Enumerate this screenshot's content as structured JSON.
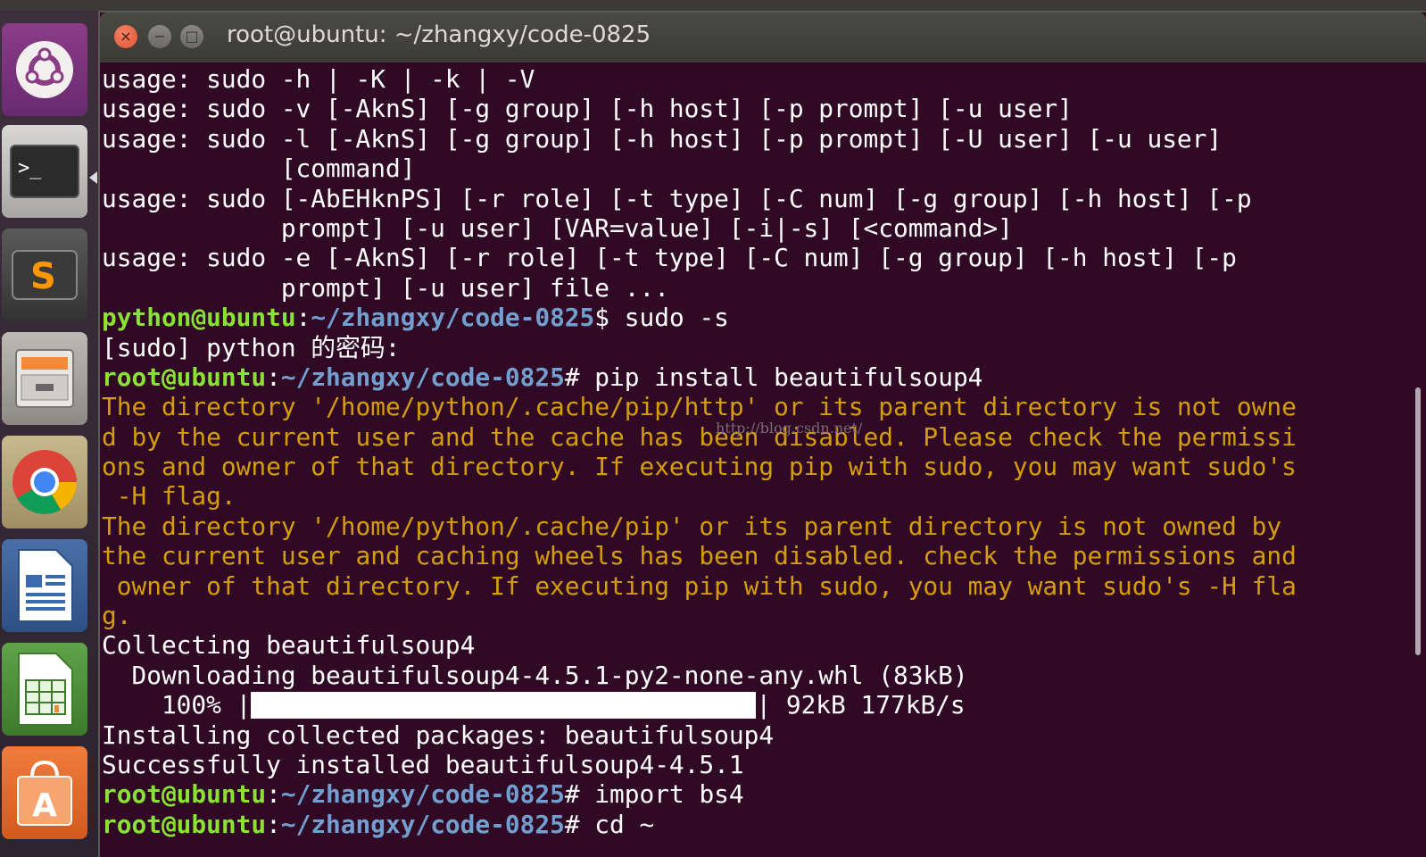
{
  "topbar": {
    "label": ""
  },
  "launcher": {
    "items": [
      {
        "name": "Ubuntu Dash",
        "icon": "ubuntu-logo-icon"
      },
      {
        "name": "Terminal",
        "icon": "terminal-icon",
        "active": true
      },
      {
        "name": "Sublime Text",
        "icon": "sublime-text-icon"
      },
      {
        "name": "Files",
        "icon": "file-cabinet-icon"
      },
      {
        "name": "Chrome",
        "icon": "chrome-icon"
      },
      {
        "name": "LibreOffice Writer",
        "icon": "writer-document-icon"
      },
      {
        "name": "LibreOffice Calc",
        "icon": "calc-spreadsheet-icon"
      },
      {
        "name": "Software Center",
        "icon": "shopping-bag-icon"
      }
    ]
  },
  "window": {
    "title": "root@ubuntu: ~/zhangxy/code-0825",
    "buttons": {
      "close": "×",
      "minimize": "−",
      "maximize": "□"
    }
  },
  "terminal": {
    "colors": {
      "background": "#300a24",
      "text": "#ffffff",
      "warning": "#d59d0d",
      "user_host": "#8ae234",
      "path": "#729fcf"
    },
    "watermark": "http://blog.csdn.net/",
    "lines": [
      {
        "text": "usage: sudo -h | -K | -k | -V"
      },
      {
        "text": "usage: sudo -v [-AknS] [-g group] [-h host] [-p prompt] [-u user]"
      },
      {
        "text": "usage: sudo -l [-AknS] [-g group] [-h host] [-p prompt] [-U user] [-u user]"
      },
      {
        "text": "            [command]"
      },
      {
        "text": "usage: sudo [-AbEHknPS] [-r role] [-t type] [-C num] [-g group] [-h host] [-p"
      },
      {
        "text": "            prompt] [-u user] [VAR=value] [-i|-s] [<command>]"
      },
      {
        "text": "usage: sudo -e [-AknS] [-r role] [-t type] [-C num] [-g group] [-h host] [-p"
      },
      {
        "text": "            prompt] [-u user] file ..."
      },
      {
        "prompt": {
          "userhost": "python@ubuntu",
          "sep": ":",
          "path": "~/zhangxy/code-0825",
          "sym": "$"
        },
        "cmd": " sudo -s"
      },
      {
        "text": "[sudo] python 的密码:"
      },
      {
        "prompt": {
          "userhost": "root@ubuntu",
          "sep": ":",
          "path": "~/zhangxy/code-0825",
          "sym": "#"
        },
        "cmd": " pip install beautifulsoup4"
      },
      {
        "text": "The directory '/home/python/.cache/pip/http' or its parent directory is not owne",
        "warn": true
      },
      {
        "text": "d by the current user and the cache has been disabled. Please check the permissi",
        "warn": true
      },
      {
        "text": "ons and owner of that directory. If executing pip with sudo, you may want sudo's",
        "warn": true
      },
      {
        "text": " -H flag.",
        "warn": true
      },
      {
        "text": "The directory '/home/python/.cache/pip' or its parent directory is not owned by",
        "warn": true
      },
      {
        "text": "the current user and caching wheels has been disabled. check the permissions and",
        "warn": true
      },
      {
        "text": " owner of that directory. If executing pip with sudo, you may want sudo's -H fla",
        "warn": true
      },
      {
        "text": "g.",
        "warn": true
      },
      {
        "text": "Collecting beautifulsoup4"
      },
      {
        "text": "  Downloading beautifulsoup4-4.5.1-py2-none-any.whl (83kB)"
      },
      {
        "progress": {
          "before": "    100% |",
          "after": "| 92kB 177kB/s",
          "value": 1.0
        }
      },
      {
        "text": "Installing collected packages: beautifulsoup4"
      },
      {
        "text": "Successfully installed beautifulsoup4-4.5.1"
      },
      {
        "prompt": {
          "userhost": "root@ubuntu",
          "sep": ":",
          "path": "~/zhangxy/code-0825",
          "sym": "#"
        },
        "cmd": " import bs4"
      },
      {
        "prompt": {
          "userhost": "root@ubuntu",
          "sep": ":",
          "path": "~/zhangxy/code-0825",
          "sym": "#"
        },
        "cmd": " cd ~"
      }
    ]
  }
}
